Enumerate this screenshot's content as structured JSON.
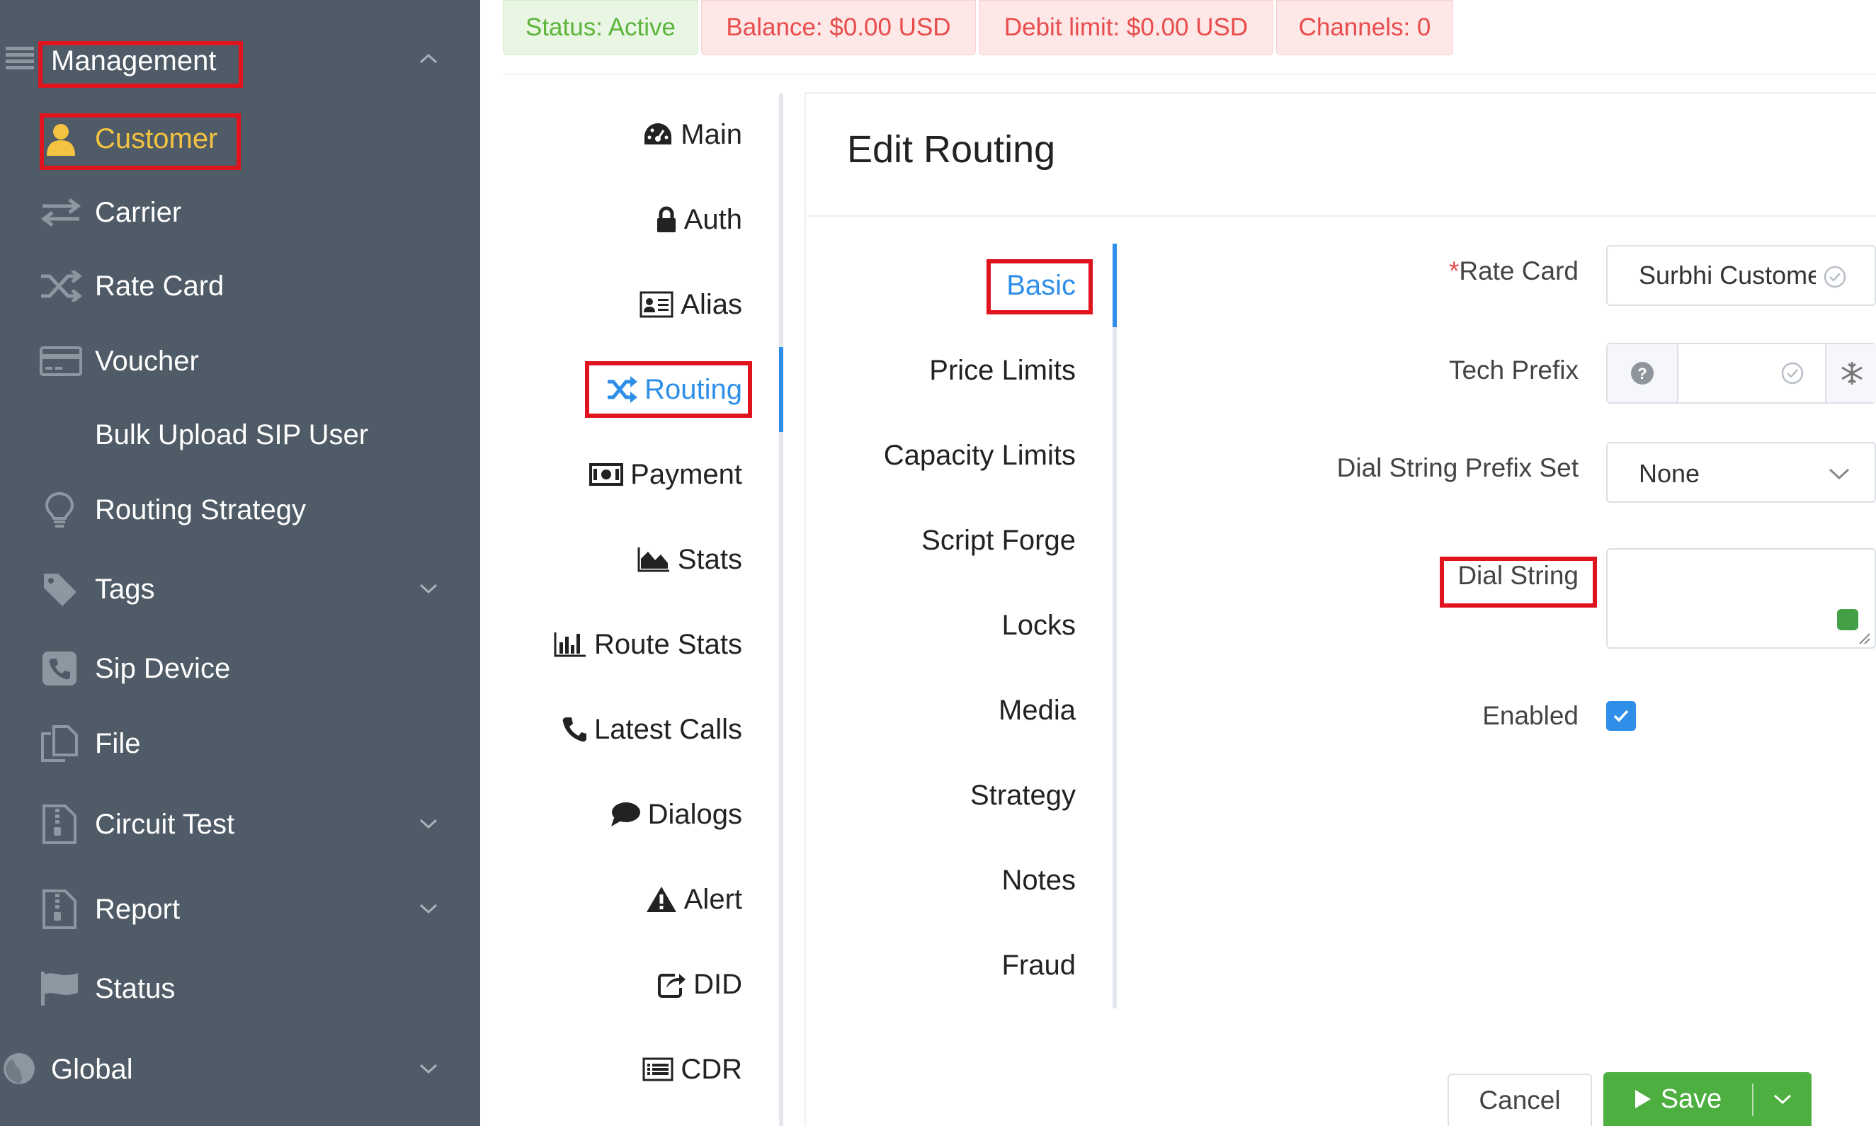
{
  "status_bar": {
    "status": "Status: Active",
    "balance": "Balance: $0.00 USD",
    "debit_limit": "Debit limit: $0.00 USD",
    "channels": "Channels: 0"
  },
  "sidebar": {
    "section_management": "Management",
    "items": [
      {
        "label": "Customer",
        "icon": "user-icon",
        "active": true
      },
      {
        "label": "Carrier",
        "icon": "exchange-icon"
      },
      {
        "label": "Rate Card",
        "icon": "shuffle-icon"
      },
      {
        "label": "Voucher",
        "icon": "credit-card-icon"
      },
      {
        "label": "Bulk Upload SIP User",
        "icon": ""
      },
      {
        "label": "Routing Strategy",
        "icon": "lightbulb-icon"
      },
      {
        "label": "Tags",
        "icon": "tag-icon",
        "expandable": true
      },
      {
        "label": "Sip Device",
        "icon": "phone-square-icon"
      },
      {
        "label": "File",
        "icon": "files-icon"
      },
      {
        "label": "Circuit Test",
        "icon": "file-zip-icon",
        "expandable": true
      },
      {
        "label": "Report",
        "icon": "file-zip-icon",
        "expandable": true
      },
      {
        "label": "Status",
        "icon": "flag-icon"
      }
    ],
    "section_global": "Global"
  },
  "left_tabs": [
    {
      "label": "Main",
      "icon": "dashboard-icon"
    },
    {
      "label": "Auth",
      "icon": "lock-icon"
    },
    {
      "label": "Alias",
      "icon": "id-card-icon"
    },
    {
      "label": "Routing",
      "icon": "random-icon",
      "active": true
    },
    {
      "label": "Payment",
      "icon": "money-icon"
    },
    {
      "label": "Stats",
      "icon": "area-chart-icon"
    },
    {
      "label": "Route Stats",
      "icon": "bar-chart-icon"
    },
    {
      "label": "Latest Calls",
      "icon": "phone-icon"
    },
    {
      "label": "Dialogs",
      "icon": "comment-icon"
    },
    {
      "label": "Alert",
      "icon": "warning-icon"
    },
    {
      "label": "DID",
      "icon": "share-square-icon"
    },
    {
      "label": "CDR",
      "icon": "list-alt-icon"
    }
  ],
  "panel": {
    "title": "Edit Routing",
    "sub_tabs": [
      {
        "label": "Basic",
        "active": true
      },
      {
        "label": "Price Limits"
      },
      {
        "label": "Capacity Limits"
      },
      {
        "label": "Script Forge"
      },
      {
        "label": "Locks"
      },
      {
        "label": "Media"
      },
      {
        "label": "Strategy"
      },
      {
        "label": "Notes"
      },
      {
        "label": "Fraud"
      }
    ],
    "form": {
      "rate_card_required_mark": "*",
      "rate_card_label": "Rate Card",
      "rate_card_value": "Surbhi Custome",
      "tech_prefix_label": "Tech Prefix",
      "tech_prefix_value": "",
      "dial_prefix_label": "Dial String Prefix Set",
      "dial_prefix_value": "None",
      "dial_string_label": "Dial String",
      "dial_string_value": "",
      "enabled_label": "Enabled",
      "enabled_checked": true
    },
    "cancel_label": "Cancel",
    "save_label": "Save"
  },
  "colors": {
    "sidebar_bg": "#4f5b66",
    "active_sidebar": "#f5c342",
    "accent_blue": "#2f8fe8",
    "highlight_red": "#e0141e",
    "save_green": "#4caf3f",
    "status_green_bg": "#e9f6e3",
    "status_red_bg": "#fde7e7"
  }
}
